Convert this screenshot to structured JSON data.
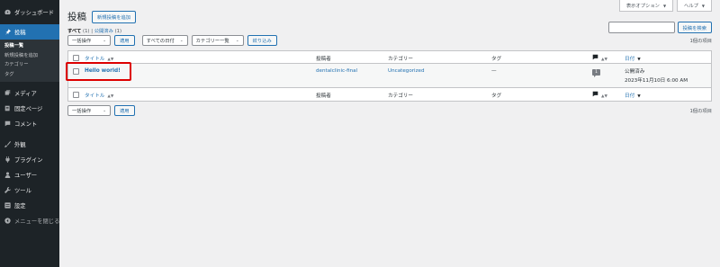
{
  "sidebar": {
    "dashboard": "ダッシュボード",
    "posts": "投稿",
    "posts_sub": [
      "投稿一覧",
      "新規投稿を追加",
      "カテゴリー",
      "タグ"
    ],
    "media": "メディア",
    "pages": "固定ページ",
    "comments": "コメント",
    "appearance": "外観",
    "plugins": "プラグイン",
    "users": "ユーザー",
    "tools": "ツール",
    "settings": "設定",
    "collapse": "メニューを閉じる"
  },
  "screen_tabs": {
    "options": "表示オプション",
    "help": "ヘルプ"
  },
  "header": {
    "title": "投稿",
    "add_new": "新規投稿を追加"
  },
  "views": {
    "all_label": "すべて",
    "all_count": "(1)",
    "sep": "|",
    "published_label": "公開済み",
    "published_count": "(1)"
  },
  "search": {
    "button": "投稿を検索",
    "placeholder": ""
  },
  "tablenav_top": {
    "bulk_action": "一括操作",
    "apply": "適用",
    "date_filter": "すべての日付",
    "category_filter": "カテゴリー一覧",
    "filter_button": "絞り込み",
    "items_count": "1個の項目"
  },
  "table": {
    "headers": {
      "title": "タイトル",
      "author": "投稿者",
      "categories": "カテゴリー",
      "tags": "タグ",
      "date": "日付"
    },
    "rows": [
      {
        "title": "Hello world!",
        "author": "dentalclinic-final",
        "category": "Uncategorized",
        "tags": "—",
        "comments": "1",
        "date_status": "公開済み",
        "date_value": "2023年11月10日 6:00 AM"
      }
    ]
  },
  "tablenav_bottom": {
    "bulk_action": "一括操作",
    "apply": "適用",
    "items_count": "1個の項目"
  },
  "colors": {
    "sidebar_bg": "#1d2327",
    "accent": "#2271b1",
    "highlight": "#dd0000"
  }
}
